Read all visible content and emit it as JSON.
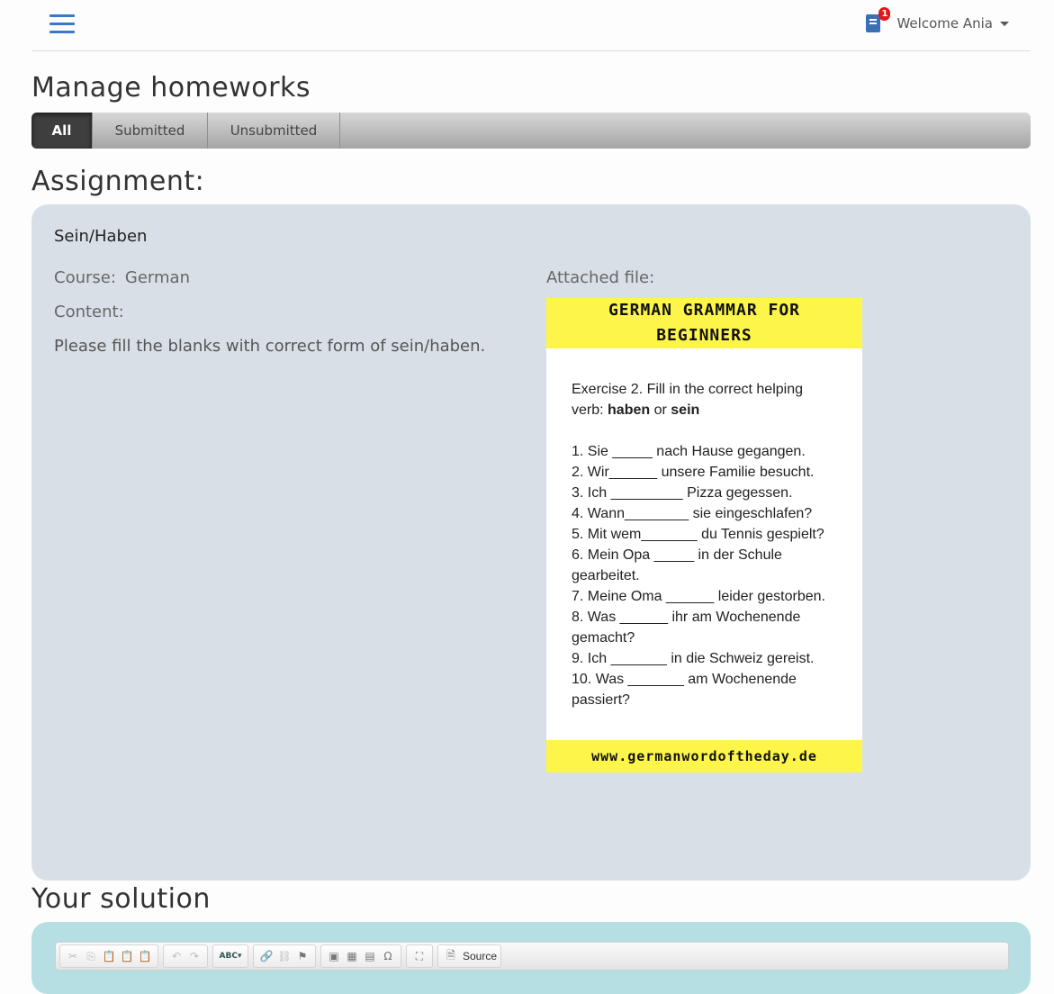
{
  "header": {
    "menu_icon": "hamburger-icon",
    "notification_icon": "book-icon",
    "notification_count": "1",
    "welcome_text": "Welcome Ania"
  },
  "page_title": "Manage homeworks",
  "tabs": [
    {
      "label": "All",
      "active": true
    },
    {
      "label": "Submitted",
      "active": false
    },
    {
      "label": "Unsubmitted",
      "active": false
    }
  ],
  "assignment": {
    "section_title": "Assignment:",
    "name": "Sein/Haben",
    "course_label": "Course:",
    "course_value": "German",
    "content_label": "Content:",
    "content_text": "Please fill the blanks with correct form of sein/haben.",
    "attached_label": "Attached file:",
    "attachment": {
      "header": "GERMAN GRAMMAR FOR BEGINNERS",
      "instruction": "Exercise 2. Fill in the correct helping verb: haben or sein",
      "instruction_prefix": "Exercise 2. Fill in the correct helping verb: ",
      "instruction_word1": "haben",
      "instruction_or": " or ",
      "instruction_word2": "sein",
      "items": [
        "1. Sie _____ nach Hause gegangen.",
        "2. Wir______ unsere Familie besucht.",
        "3. Ich _________ Pizza gegessen.",
        "4. Wann________ sie eingeschlafen?",
        "5. Mit wem_______ du Tennis gespielt?",
        "6. Mein Opa _____ in der Schule gearbeitet.",
        "7. Meine Oma ______ leider gestorben.",
        "8. Was ______ ihr am Wochenende gemacht?",
        "9. Ich _______ in die Schweiz gereist.",
        "10. Was _______ am Wochenende passiert?"
      ],
      "footer": "www.germanwordoftheday.de"
    }
  },
  "solution": {
    "section_title": "Your solution",
    "toolbar": {
      "source_label": "Source",
      "spellcheck_label": "ABC",
      "groups": [
        [
          "cut-icon",
          "copy-icon",
          "paste-icon",
          "paste-text-icon",
          "paste-word-icon"
        ],
        [
          "undo-icon",
          "redo-icon"
        ],
        [
          "spellcheck-icon"
        ],
        [
          "link-icon",
          "unlink-icon",
          "anchor-icon"
        ],
        [
          "image-icon",
          "table-icon",
          "horizontal-rule-icon",
          "special-char-icon"
        ],
        [
          "maximize-icon"
        ],
        [
          "source-icon"
        ]
      ]
    }
  }
}
